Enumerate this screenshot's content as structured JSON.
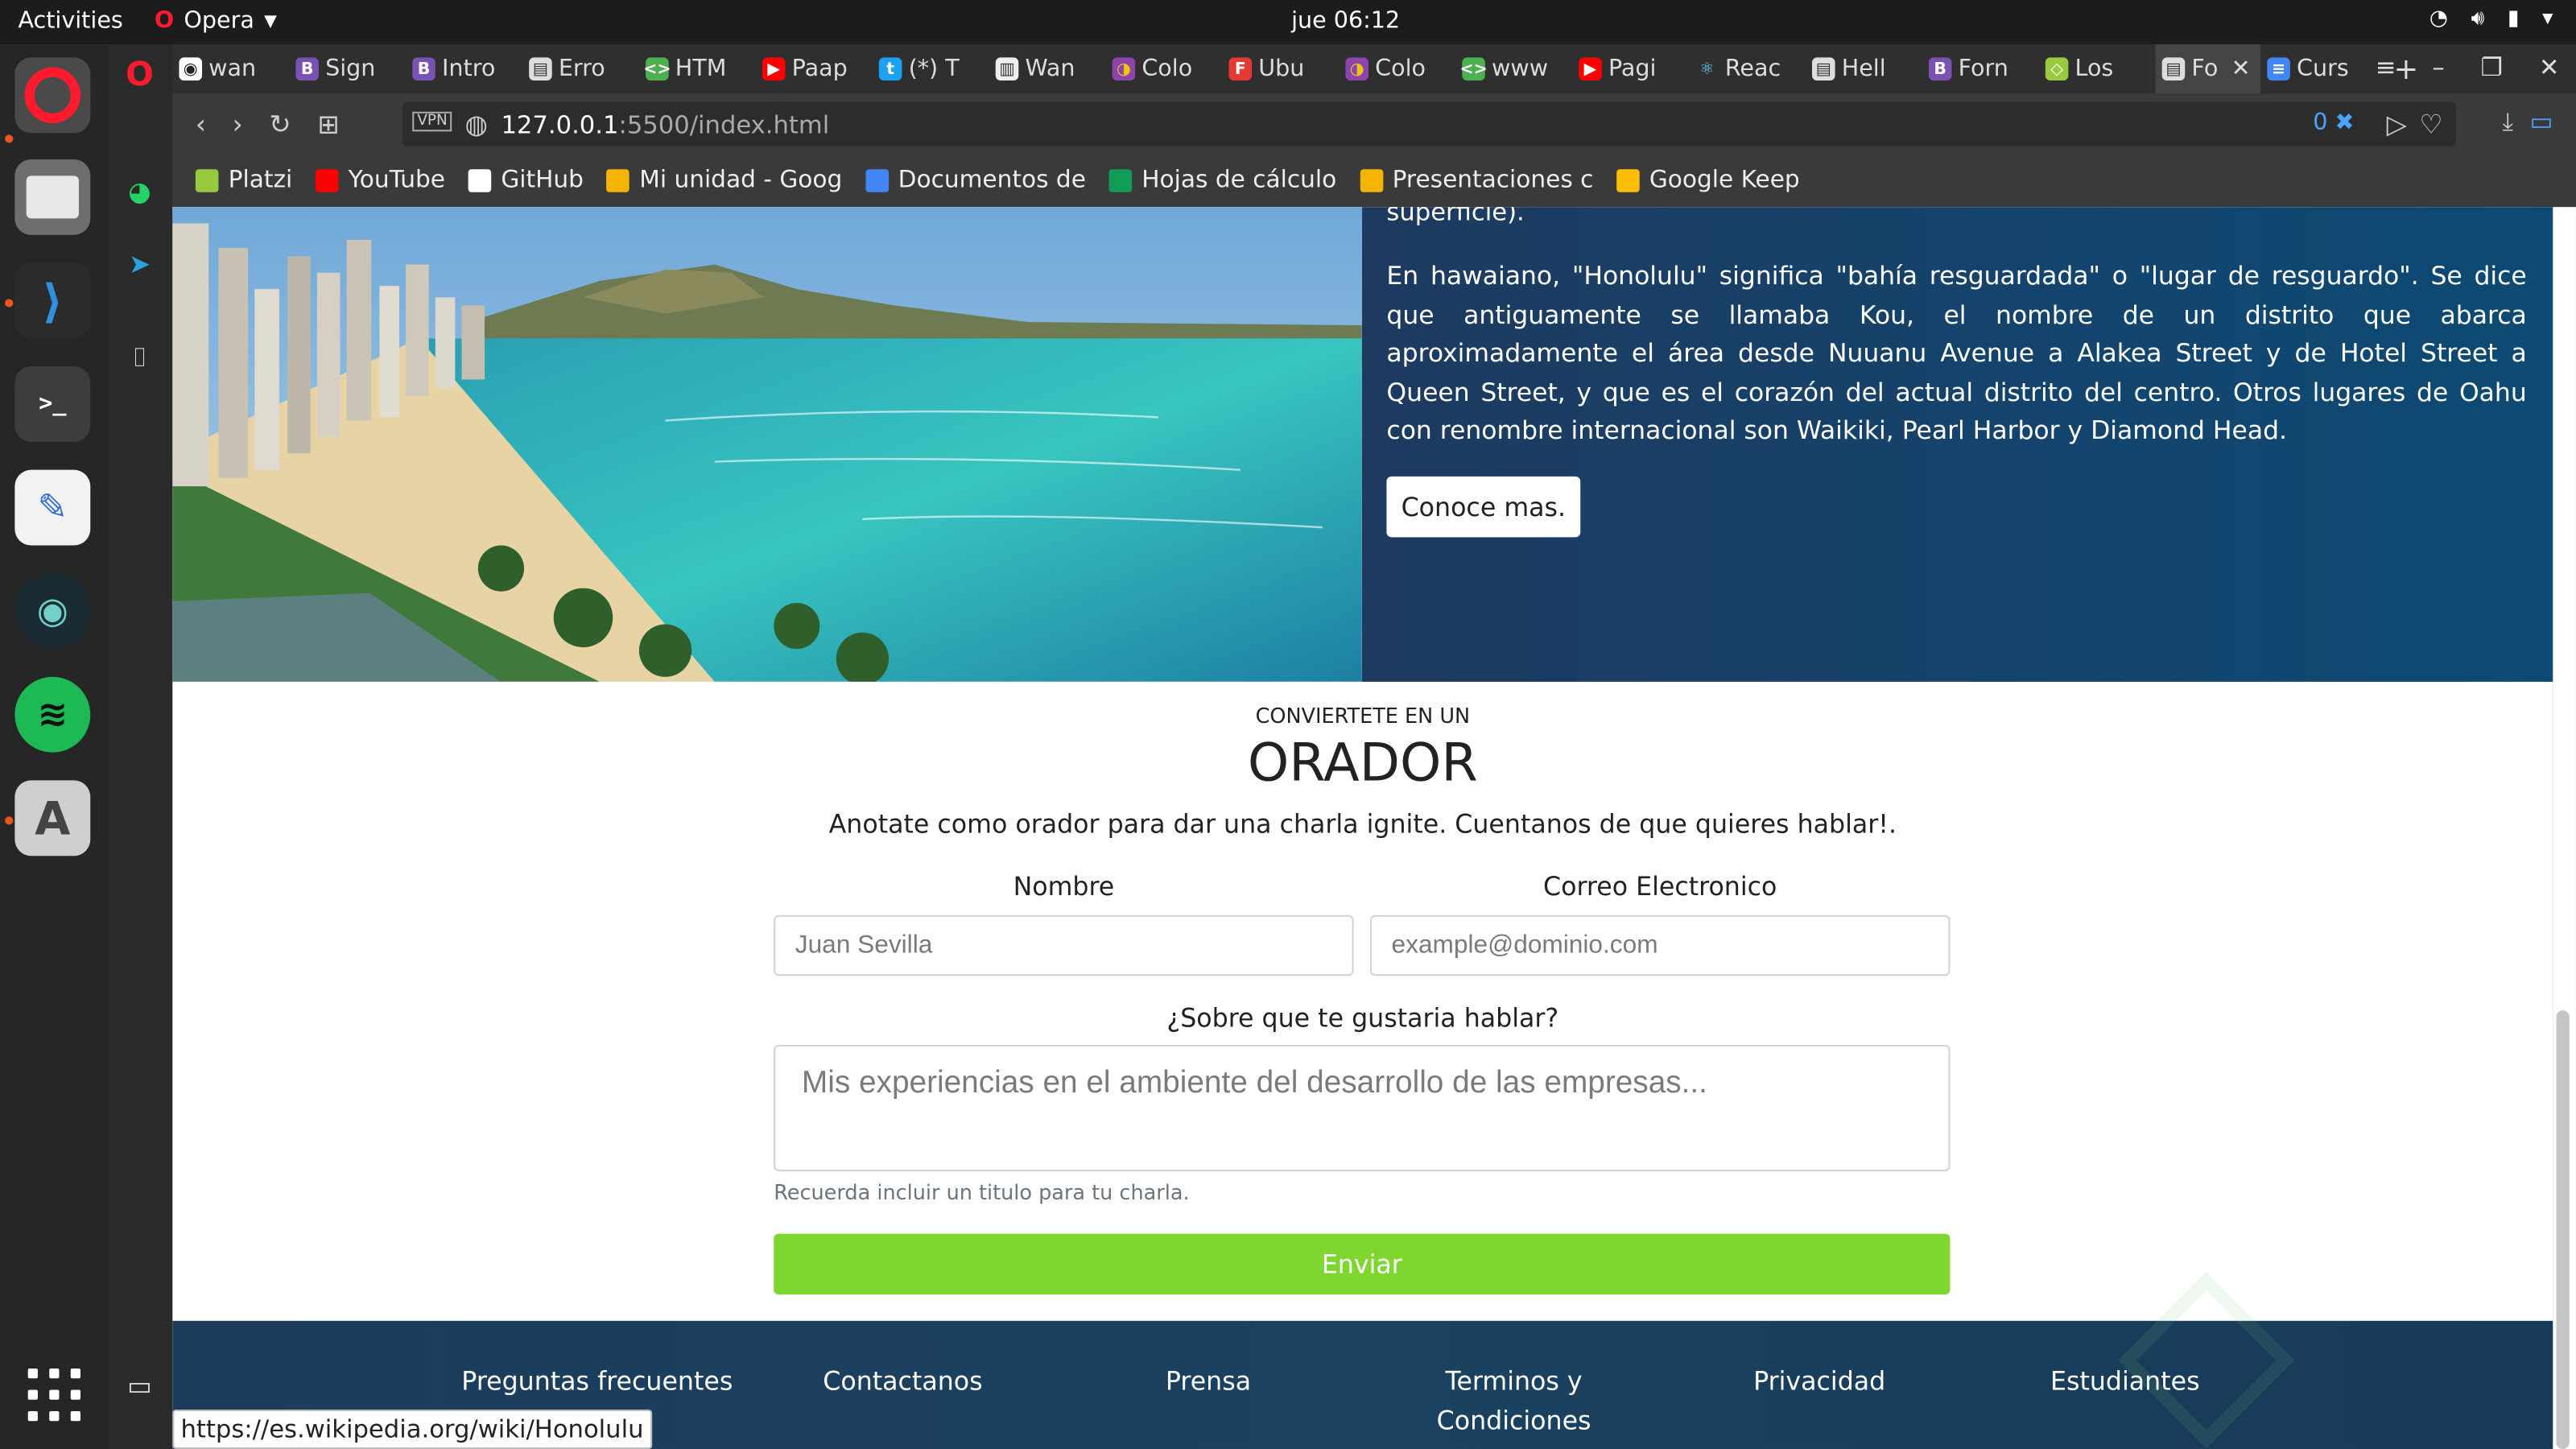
{
  "topbar": {
    "activities": "Activities",
    "browser": "Opera",
    "clock": "jue 06:12"
  },
  "tabs": [
    {
      "label": "wan",
      "icon": "github-icon"
    },
    {
      "label": "Sign",
      "icon": "bootstrap-icon"
    },
    {
      "label": "Intro",
      "icon": "bootstrap-icon"
    },
    {
      "label": "Erro",
      "icon": "document-icon"
    },
    {
      "label": "HTM",
      "icon": "html-icon"
    },
    {
      "label": "Paap",
      "icon": "youtube-icon"
    },
    {
      "label": "(*) T",
      "icon": "twitter-icon"
    },
    {
      "label": "Wan",
      "icon": "page-icon"
    },
    {
      "label": "Colo",
      "icon": "color-icon"
    },
    {
      "label": "Ubu",
      "icon": "f-icon"
    },
    {
      "label": "Colo",
      "icon": "color-icon"
    },
    {
      "label": "www",
      "icon": "html-icon"
    },
    {
      "label": "Pagi",
      "icon": "youtube-icon"
    },
    {
      "label": "Reac",
      "icon": "react-icon"
    },
    {
      "label": "Hell",
      "icon": "document-icon"
    },
    {
      "label": "Forn",
      "icon": "bootstrap-icon"
    },
    {
      "label": "Los",
      "icon": "platzi-icon"
    },
    {
      "label": "Fo",
      "icon": "document-icon"
    },
    {
      "label": "Curs",
      "icon": "docs-icon"
    }
  ],
  "address": {
    "host": "127.0.0.1",
    "path": ":5500/index.html",
    "badge": "0"
  },
  "bookmarks": [
    {
      "label": "Platzi",
      "color": "#98ca3f"
    },
    {
      "label": "YouTube",
      "color": "#ff0000"
    },
    {
      "label": "GitHub",
      "color": "#ffffff"
    },
    {
      "label": "Mi unidad - Goog",
      "color": "#f4b400"
    },
    {
      "label": "Documentos de",
      "color": "#4285f4"
    },
    {
      "label": "Hojas de cálculo",
      "color": "#0f9d58"
    },
    {
      "label": "Presentaciones c",
      "color": "#f4b400"
    },
    {
      "label": "Google Keep",
      "color": "#fbbc04"
    }
  ],
  "hero": {
    "cut_text": "superficie).",
    "paragraph": "En hawaiano, \"Honolulu\" significa \"bahía resguardada\" o \"lugar de resguardo\". Se dice que antiguamente se llamaba Kou, el nombre de un distrito que abarca aproximadamente el área desde Nuuanu Avenue a Alakea Street y de Hotel Street a Queen Street, y que es el corazón del actual distrito del centro. Otros lugares de Oahu con renombre internacional son Waikiki, Pearl Harbor y Diamond Head.",
    "button": "Conoce mas."
  },
  "form": {
    "subtitle": "CONVIERTETE EN UN",
    "title": "ORADOR",
    "lead": "Anotate como orador para dar una charla ignite. Cuentanos de que quieres hablar!.",
    "name_label": "Nombre",
    "name_placeholder": "Juan Sevilla",
    "email_label": "Correo Electronico",
    "email_placeholder": "example@dominio.com",
    "topic_label": "¿Sobre que te gustaria hablar?",
    "topic_placeholder": "Mis experiencias en el ambiente del desarrollo de las empresas...",
    "hint": "Recuerda incluir un titulo para tu charla.",
    "submit": "Enviar"
  },
  "footer": {
    "links": [
      "Preguntas frecuentes",
      "Contactanos",
      "Prensa",
      "Terminos y",
      "Privacidad",
      "Estudiantes"
    ],
    "link4_line2": "Condiciones"
  },
  "status_url": "https://es.wikipedia.org/wiki/Honolulu",
  "colors": {
    "accent_green": "#7ed62f",
    "hero_blue": "#13456e"
  }
}
